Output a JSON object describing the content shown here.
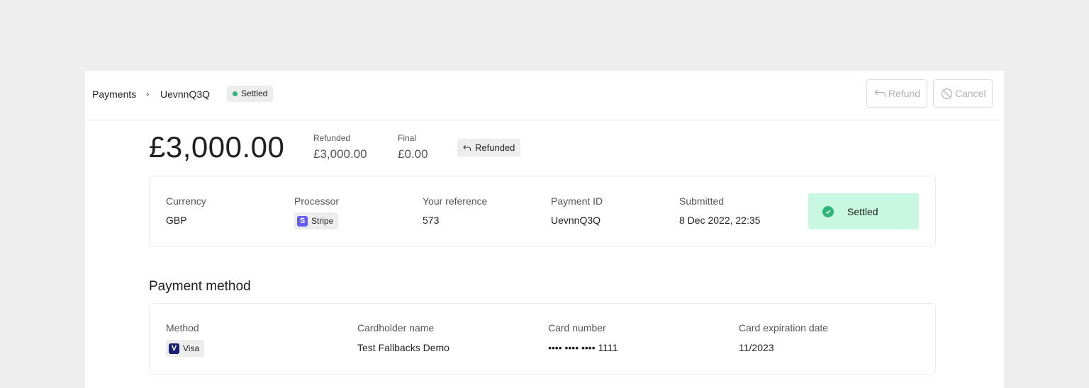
{
  "breadcrumb": {
    "root": "Payments",
    "separator": "›",
    "current": "UevnnQ3Q"
  },
  "top_badge": {
    "label": "Settled",
    "color": "#2fb67c"
  },
  "actions": {
    "refund_label": "Refund",
    "cancel_label": "Cancel"
  },
  "amount": {
    "total": "£3,000.00",
    "refunded_label": "Refunded",
    "refunded_value": "£3,000.00",
    "final_label": "Final",
    "final_value": "£0.00",
    "badge": "Refunded"
  },
  "summary": {
    "currency_label": "Currency",
    "currency_value": "GBP",
    "processor_label": "Processor",
    "processor_value": "Stripe",
    "processor_icon": "S",
    "reference_label": "Your reference",
    "reference_value": "573",
    "payment_id_label": "Payment ID",
    "payment_id_value": "UevnnQ3Q",
    "submitted_label": "Submitted",
    "submitted_value": "8 Dec 2022, 22:35",
    "status": "Settled"
  },
  "payment_method": {
    "title": "Payment method",
    "method_label": "Method",
    "method_value": "Visa",
    "method_icon": "V",
    "cardholder_label": "Cardholder name",
    "cardholder_value": "Test Fallbacks Demo",
    "card_number_label": "Card number",
    "card_number_value": "•••• •••• •••• 1111",
    "expiry_label": "Card expiration date",
    "expiry_value": "11/2023"
  },
  "colors": {
    "accent_green": "#2fb67c",
    "status_bg": "#c8f7e2",
    "stripe": "#635bff",
    "visa": "#1a1f71"
  }
}
